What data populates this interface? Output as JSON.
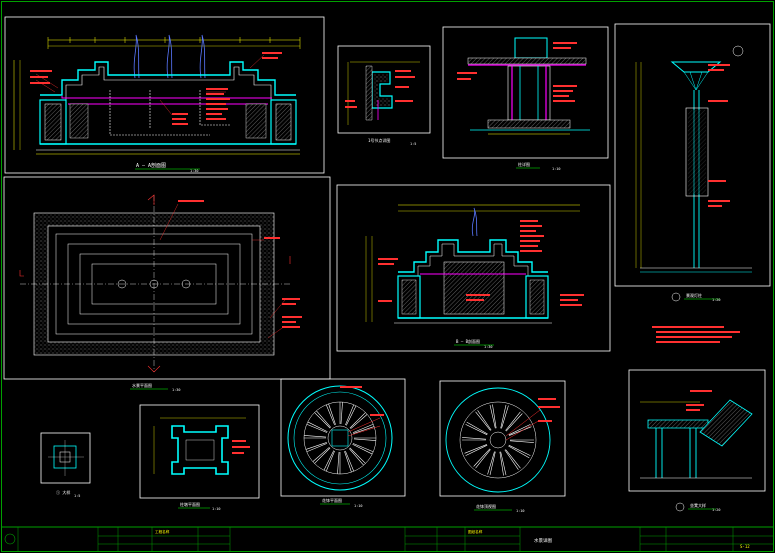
{
  "colors": {
    "background": "#000000",
    "frame": "#ffffff",
    "sheet_border": "#00a000",
    "dimension": "#ffff00",
    "annotation": "#ff3030",
    "structure": "#00ffff",
    "finish": "#ff00ff",
    "water_jet": "#5a78ff",
    "hatch": "#b0b0b0"
  },
  "drawings": {
    "top_section": {
      "caption": "A – A剖面图",
      "scale": "1:30"
    },
    "joint_detail": {
      "caption": "1号节点详图",
      "scale": "1:5"
    },
    "column_section": {
      "caption": "柱详图",
      "scale": "1:10"
    },
    "lamp_post": {
      "caption": "景观灯柱",
      "scale": "1:20"
    },
    "plan": {
      "caption": "水景平面图",
      "scale": "1:30"
    },
    "mid_section": {
      "caption": "B – B剖面图",
      "scale": "1:30"
    },
    "small_detail": {
      "caption": "① 大样",
      "scale": "1:5"
    },
    "pillar_plan": {
      "caption": "柱墩平面图",
      "scale": "1:10"
    },
    "round_plan_a": {
      "caption": "花钵平面图",
      "scale": "1:10"
    },
    "round_plan_b": {
      "caption": "花钵顶视图",
      "scale": "1:10"
    },
    "bench_detail": {
      "caption": "坐凳大样",
      "scale": "1:20"
    }
  },
  "title_block": {
    "project_label": "工程名称",
    "drawing_label": "图纸名称",
    "drawing_name": "水景详图",
    "sheet_no": "S-12"
  }
}
